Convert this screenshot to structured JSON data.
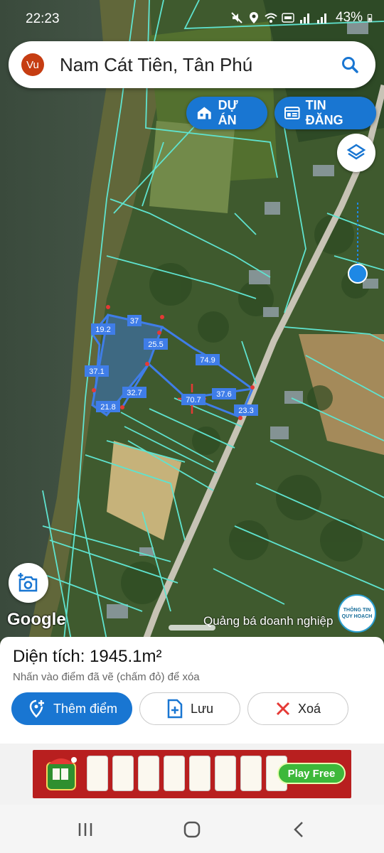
{
  "status_bar": {
    "time": "22:23",
    "battery_pct": "43%"
  },
  "search": {
    "avatar_text": "Vu",
    "query": "Nam Cát Tiên, Tân Phú",
    "icon": "search-icon"
  },
  "chips": {
    "du_an": "DỰ ÁN",
    "tin_dang": "TIN ĐĂNG"
  },
  "map": {
    "measurements": [
      "37",
      "19.2",
      "25.5",
      "74.9",
      "37.1",
      "32.7",
      "37.6",
      "21.8",
      "23.3",
      "70.7"
    ],
    "google_label": "Google",
    "ad_caption": "Quảng bá doanh nghiệp",
    "badge_line1": "THÔNG TIN",
    "badge_line2": "QUY HOẠCH",
    "colors": {
      "polygon": "#3f7de8",
      "parcel_lines": "#5fe3cf",
      "vertex": "#e53935"
    }
  },
  "panel": {
    "area_text": "Diện tích: 1945.1m²",
    "hint": "Nhấn vào điểm đã vẽ (chấm đỏ) để xóa",
    "add_label": "Thêm điểm",
    "save_label": "Lưu",
    "delete_label": "Xoá"
  },
  "ad": {
    "cta": "Play Free"
  },
  "accent": "#1976d2"
}
